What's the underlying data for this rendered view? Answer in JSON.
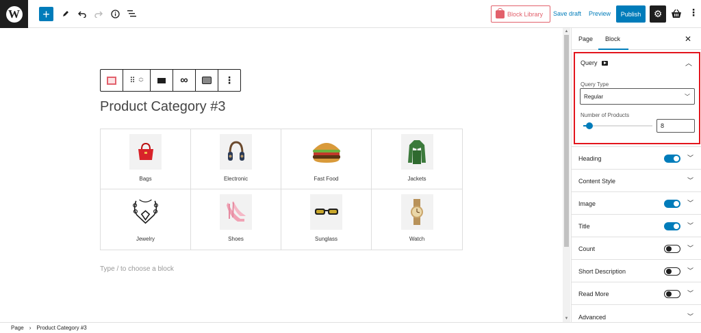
{
  "topbar": {
    "wp_logo": "W",
    "add_label": "+",
    "block_library": "Block Library",
    "save_draft": "Save draft",
    "preview": "Preview",
    "publish": "Publish"
  },
  "editor": {
    "title": "Product Category #3",
    "appender_placeholder": "Type / to choose a block",
    "categories": [
      {
        "label": "Bags",
        "icon": "handbag-image"
      },
      {
        "label": "Electronic",
        "icon": "headphones-image"
      },
      {
        "label": "Fast Food",
        "icon": "burger-image"
      },
      {
        "label": "Jackets",
        "icon": "jacket-image"
      },
      {
        "label": "Jewelry",
        "icon": "necklace-image"
      },
      {
        "label": "Shoes",
        "icon": "heels-image"
      },
      {
        "label": "Sunglass",
        "icon": "sunglasses-image"
      },
      {
        "label": "Watch",
        "icon": "watch-image"
      }
    ]
  },
  "sidebar": {
    "tab_page": "Page",
    "tab_block": "Block",
    "query": {
      "title": "Query",
      "query_type_label": "Query Type",
      "query_type_value": "Regular",
      "num_products_label": "Number of Products",
      "num_products_value": "8"
    },
    "rows": [
      {
        "label": "Heading",
        "toggle": "on"
      },
      {
        "label": "Content Style",
        "toggle": "none"
      },
      {
        "label": "Image",
        "toggle": "on"
      },
      {
        "label": "Title",
        "toggle": "on"
      },
      {
        "label": "Count",
        "toggle": "off"
      },
      {
        "label": "Short Description",
        "toggle": "off"
      },
      {
        "label": "Read More",
        "toggle": "off"
      },
      {
        "label": "Advanced",
        "toggle": "none"
      }
    ]
  },
  "footer": {
    "crumb_root": "Page",
    "crumb_current": "Product Category #3"
  },
  "colors": {
    "accent": "#007cba",
    "brand_pink": "#e2606b",
    "highlight_red": "#e3141c"
  }
}
